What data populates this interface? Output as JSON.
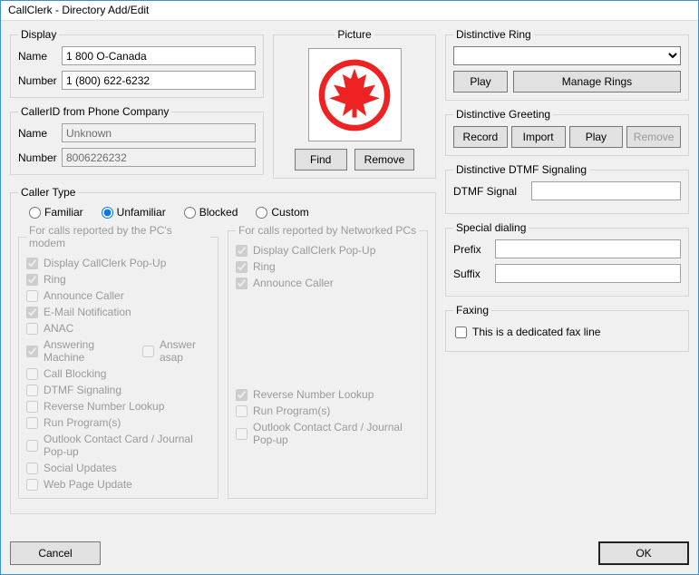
{
  "window": {
    "title": "CallClerk - Directory Add/Edit"
  },
  "display": {
    "legend": "Display",
    "name_label": "Name",
    "name_value": "1 800 O-Canada",
    "number_label": "Number",
    "number_value": "1 (800) 622-6232"
  },
  "callerid": {
    "legend": "CallerID from Phone Company",
    "name_label": "Name",
    "name_value": "Unknown",
    "number_label": "Number",
    "number_value": "8006226232"
  },
  "picture": {
    "legend": "Picture",
    "find": "Find",
    "remove": "Remove",
    "icon_name": "maple-leaf-icon"
  },
  "caller_type": {
    "legend": "Caller Type",
    "options": [
      "Familiar",
      "Unfamiliar",
      "Blocked",
      "Custom"
    ],
    "selected": "Unfamiliar"
  },
  "modem_group": {
    "legend": "For calls reported by the PC's modem",
    "items": [
      {
        "label": "Display CallClerk Pop-Up",
        "checked": true
      },
      {
        "label": "Ring",
        "checked": true
      },
      {
        "label": "Announce Caller",
        "checked": false
      },
      {
        "label": "E-Mail Notification",
        "checked": true
      },
      {
        "label": "ANAC",
        "checked": false
      },
      {
        "label": "Answering Machine",
        "checked": true,
        "inline": {
          "label": "Answer asap",
          "checked": false
        }
      },
      {
        "label": "Call Blocking",
        "checked": false
      },
      {
        "label": "DTMF Signaling",
        "checked": false
      },
      {
        "label": "Reverse Number Lookup",
        "checked": false
      },
      {
        "label": "Run Program(s)",
        "checked": false
      },
      {
        "label": "Outlook Contact Card / Journal Pop-up",
        "checked": false
      },
      {
        "label": "Social Updates",
        "checked": false
      },
      {
        "label": "Web Page Update",
        "checked": false
      }
    ]
  },
  "network_group": {
    "legend": "For calls reported by Networked PCs",
    "items": [
      {
        "label": "Display CallClerk Pop-Up",
        "checked": true
      },
      {
        "label": "Ring",
        "checked": true
      },
      {
        "label": "Announce Caller",
        "checked": true
      },
      {
        "spacer": true
      },
      {
        "spacer": true
      },
      {
        "spacer": true
      },
      {
        "spacer": true
      },
      {
        "spacer": true
      },
      {
        "label": "Reverse Number Lookup",
        "checked": true
      },
      {
        "label": "Run Program(s)",
        "checked": false
      },
      {
        "label": "Outlook Contact Card / Journal Pop-up",
        "checked": false
      }
    ]
  },
  "ring": {
    "legend": "Distinctive Ring",
    "play": "Play",
    "manage": "Manage Rings",
    "value": ""
  },
  "greeting": {
    "legend": "Distinctive Greeting",
    "record": "Record",
    "import": "Import",
    "play": "Play",
    "remove": "Remove"
  },
  "dtmf": {
    "legend": "Distinctive DTMF Signaling",
    "label": "DTMF Signal",
    "value": ""
  },
  "dialing": {
    "legend": "Special dialing",
    "prefix_label": "Prefix",
    "prefix_value": "",
    "suffix_label": "Suffix",
    "suffix_value": ""
  },
  "faxing": {
    "legend": "Faxing",
    "label": "This is a dedicated fax line",
    "checked": false
  },
  "buttons": {
    "cancel": "Cancel",
    "ok": "OK"
  }
}
